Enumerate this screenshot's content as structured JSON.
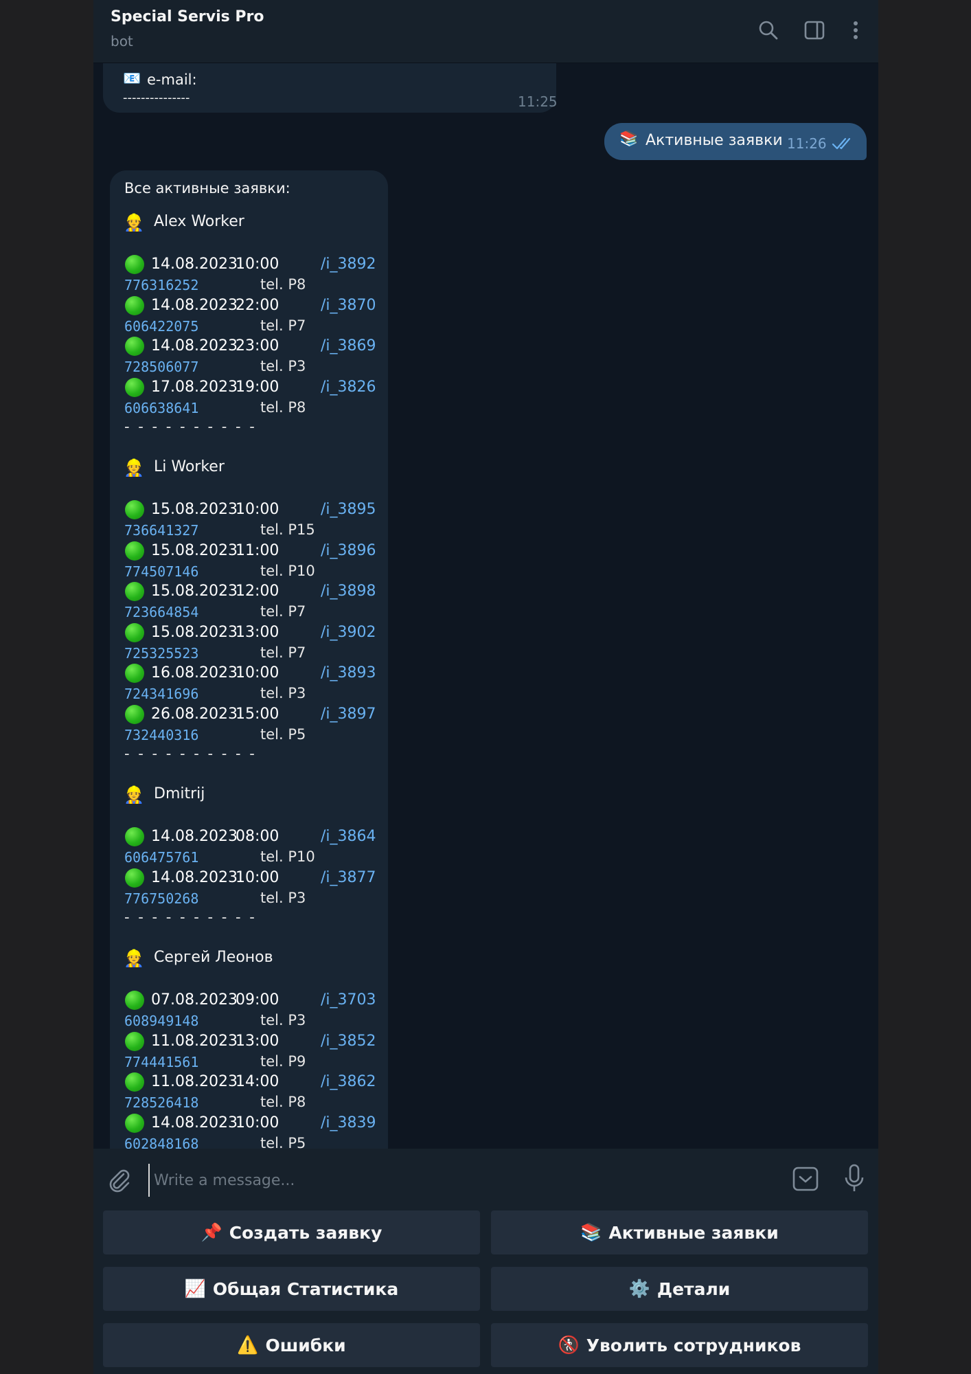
{
  "header": {
    "title": "Special Servis Pro",
    "status": "bot",
    "icons": [
      "search-icon",
      "sidebar-toggle-icon",
      "more-vertical-icon"
    ]
  },
  "messages": {
    "prev_bot": {
      "email_icon": "📧",
      "email_label": "e-mail:",
      "dashes": "---------------",
      "time": "11:25"
    },
    "user_msg": {
      "icon": "📚",
      "text": "Активные заявки",
      "time": "11:26",
      "status": "read"
    },
    "active_list": {
      "header": "Все активные заявки:",
      "worker_icon": "👷",
      "separator": "- - - - - - - - - -",
      "workers": [
        {
          "name": "Alex Worker",
          "orders": [
            {
              "date": "14.08.2023",
              "time": "10:00",
              "cmd": "/i_3892",
              "phone": "776316252",
              "tel": "tel. P8"
            },
            {
              "date": "14.08.2023",
              "time": "22:00",
              "cmd": "/i_3870",
              "phone": "606422075",
              "tel": "tel. P7"
            },
            {
              "date": "14.08.2023",
              "time": "23:00",
              "cmd": "/i_3869",
              "phone": "728506077",
              "tel": "tel. P3"
            },
            {
              "date": "17.08.2023",
              "time": "19:00",
              "cmd": "/i_3826",
              "phone": "606638641",
              "tel": "tel. P8"
            }
          ]
        },
        {
          "name": "Li Worker",
          "orders": [
            {
              "date": "15.08.2023",
              "time": "10:00",
              "cmd": "/i_3895",
              "phone": "736641327",
              "tel": "tel. P15"
            },
            {
              "date": "15.08.2023",
              "time": "11:00",
              "cmd": "/i_3896",
              "phone": "774507146",
              "tel": "tel. P10"
            },
            {
              "date": "15.08.2023",
              "time": "12:00",
              "cmd": "/i_3898",
              "phone": "723664854",
              "tel": "tel. P7"
            },
            {
              "date": "15.08.2023",
              "time": "13:00",
              "cmd": "/i_3902",
              "phone": "725325523",
              "tel": "tel. P7"
            },
            {
              "date": "16.08.2023",
              "time": "10:00",
              "cmd": "/i_3893",
              "phone": "724341696",
              "tel": "tel. P3"
            },
            {
              "date": "26.08.2023",
              "time": "15:00",
              "cmd": "/i_3897",
              "phone": "732440316",
              "tel": "tel. P5"
            }
          ]
        },
        {
          "name": "Dmitrij",
          "orders": [
            {
              "date": "14.08.2023",
              "time": "08:00",
              "cmd": "/i_3864",
              "phone": "606475761",
              "tel": "tel. P10"
            },
            {
              "date": "14.08.2023",
              "time": "10:00",
              "cmd": "/i_3877",
              "phone": "776750268",
              "tel": "tel. P3"
            }
          ]
        },
        {
          "name": "Сергей Леонов",
          "orders": [
            {
              "date": "07.08.2023",
              "time": "09:00",
              "cmd": "/i_3703",
              "phone": "608949148",
              "tel": "tel. P3"
            },
            {
              "date": "11.08.2023",
              "time": "13:00",
              "cmd": "/i_3852",
              "phone": "774441561",
              "tel": "tel. P9"
            },
            {
              "date": "11.08.2023",
              "time": "14:00",
              "cmd": "/i_3862",
              "phone": "728526418",
              "tel": "tel. P8"
            },
            {
              "date": "14.08.2023",
              "time": "10:00",
              "cmd": "/i_3839",
              "phone": "602848168",
              "tel": "tel. P5"
            }
          ]
        }
      ]
    }
  },
  "composer": {
    "placeholder": "Write a message..."
  },
  "keyboard": {
    "buttons": [
      {
        "icon": "📌",
        "label": "Создать заявку"
      },
      {
        "icon": "📚",
        "label": "Активные заявки"
      },
      {
        "icon": "📈",
        "label": "Общая Статистика"
      },
      {
        "icon": "⚙️",
        "label": "Детали"
      },
      {
        "icon": "⚠️",
        "label": "Ошибки"
      },
      {
        "icon": "🚷",
        "label": "Уволить сотрудников"
      }
    ]
  },
  "colors": {
    "app_bg": "#0e1621",
    "header_bg": "#17212b",
    "bubble_in": "#182533",
    "bubble_out": "#2b5278",
    "link": "#6ab2f2",
    "kb_button": "#232e3c"
  }
}
